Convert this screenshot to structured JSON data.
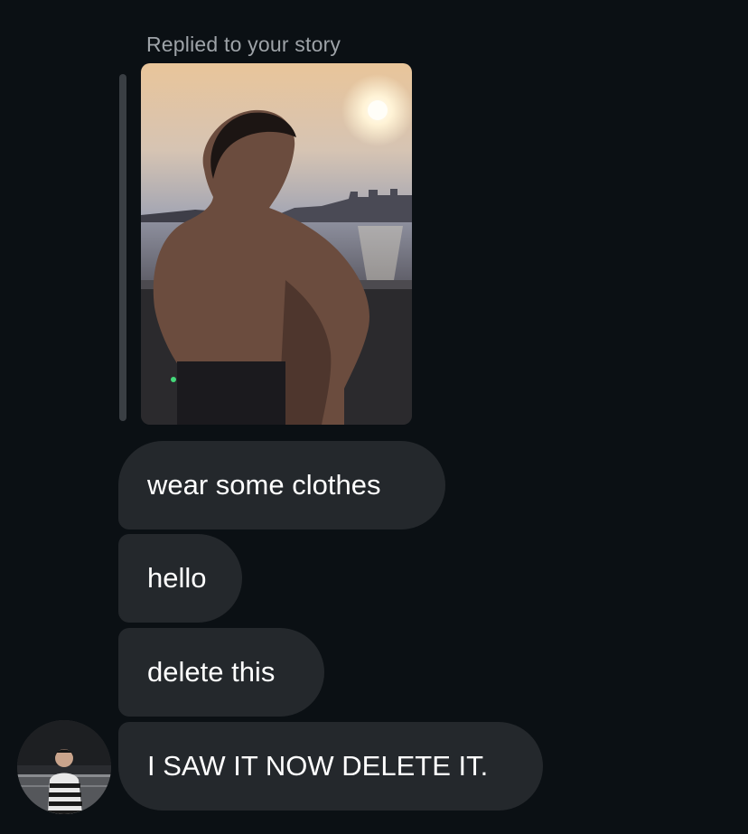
{
  "reply": {
    "label": "Replied to your story"
  },
  "messages": [
    {
      "text": "wear some clothes"
    },
    {
      "text": "hello"
    },
    {
      "text": "delete this"
    },
    {
      "text": "I SAW IT NOW DELETE IT."
    }
  ],
  "colors": {
    "background": "#0b1014",
    "bubble": "#24282c",
    "bubble_text": "#ffffff",
    "label_text": "#9ea3a8",
    "reply_bar": "#3a3f44"
  },
  "icons": {
    "story": "story-photo-thumbnail",
    "avatar": "sender-avatar"
  }
}
